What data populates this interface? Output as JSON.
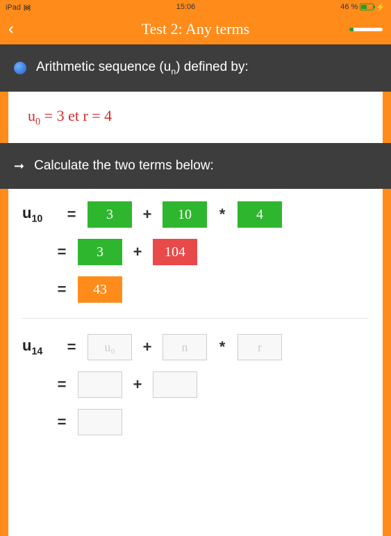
{
  "status": {
    "device": "iPad",
    "wifi": "᯾",
    "time": "15:06",
    "battery_pct": "46 %",
    "charging": true
  },
  "nav": {
    "title": "Test 2: Any terms",
    "back_icon": "‹"
  },
  "header": {
    "sequence_text": "Arithmetic sequence (u",
    "sequence_sub": "n",
    "sequence_close": ") defined by:"
  },
  "formula": {
    "u_label": "u",
    "u_sub": "0",
    "eq": " = 3  et  r = 4"
  },
  "instruction": {
    "arrow": "➞",
    "text": "Calculate the two terms below:"
  },
  "problem1": {
    "term": "u",
    "term_sub": "10",
    "row1": {
      "a": "3",
      "plus": "+",
      "b": "10",
      "mult": "*",
      "c": "4"
    },
    "row2": {
      "a": "3",
      "plus": "+",
      "b": "104"
    },
    "row3": {
      "a": "43"
    }
  },
  "problem2": {
    "term": "u",
    "term_sub": "14",
    "row1": {
      "a": "u₀",
      "plus": "+",
      "b": "n",
      "mult": "*",
      "c": "r"
    },
    "row2": {
      "a": "",
      "plus": "+",
      "b": ""
    },
    "row3": {
      "a": ""
    }
  },
  "symbols": {
    "equals": "="
  }
}
